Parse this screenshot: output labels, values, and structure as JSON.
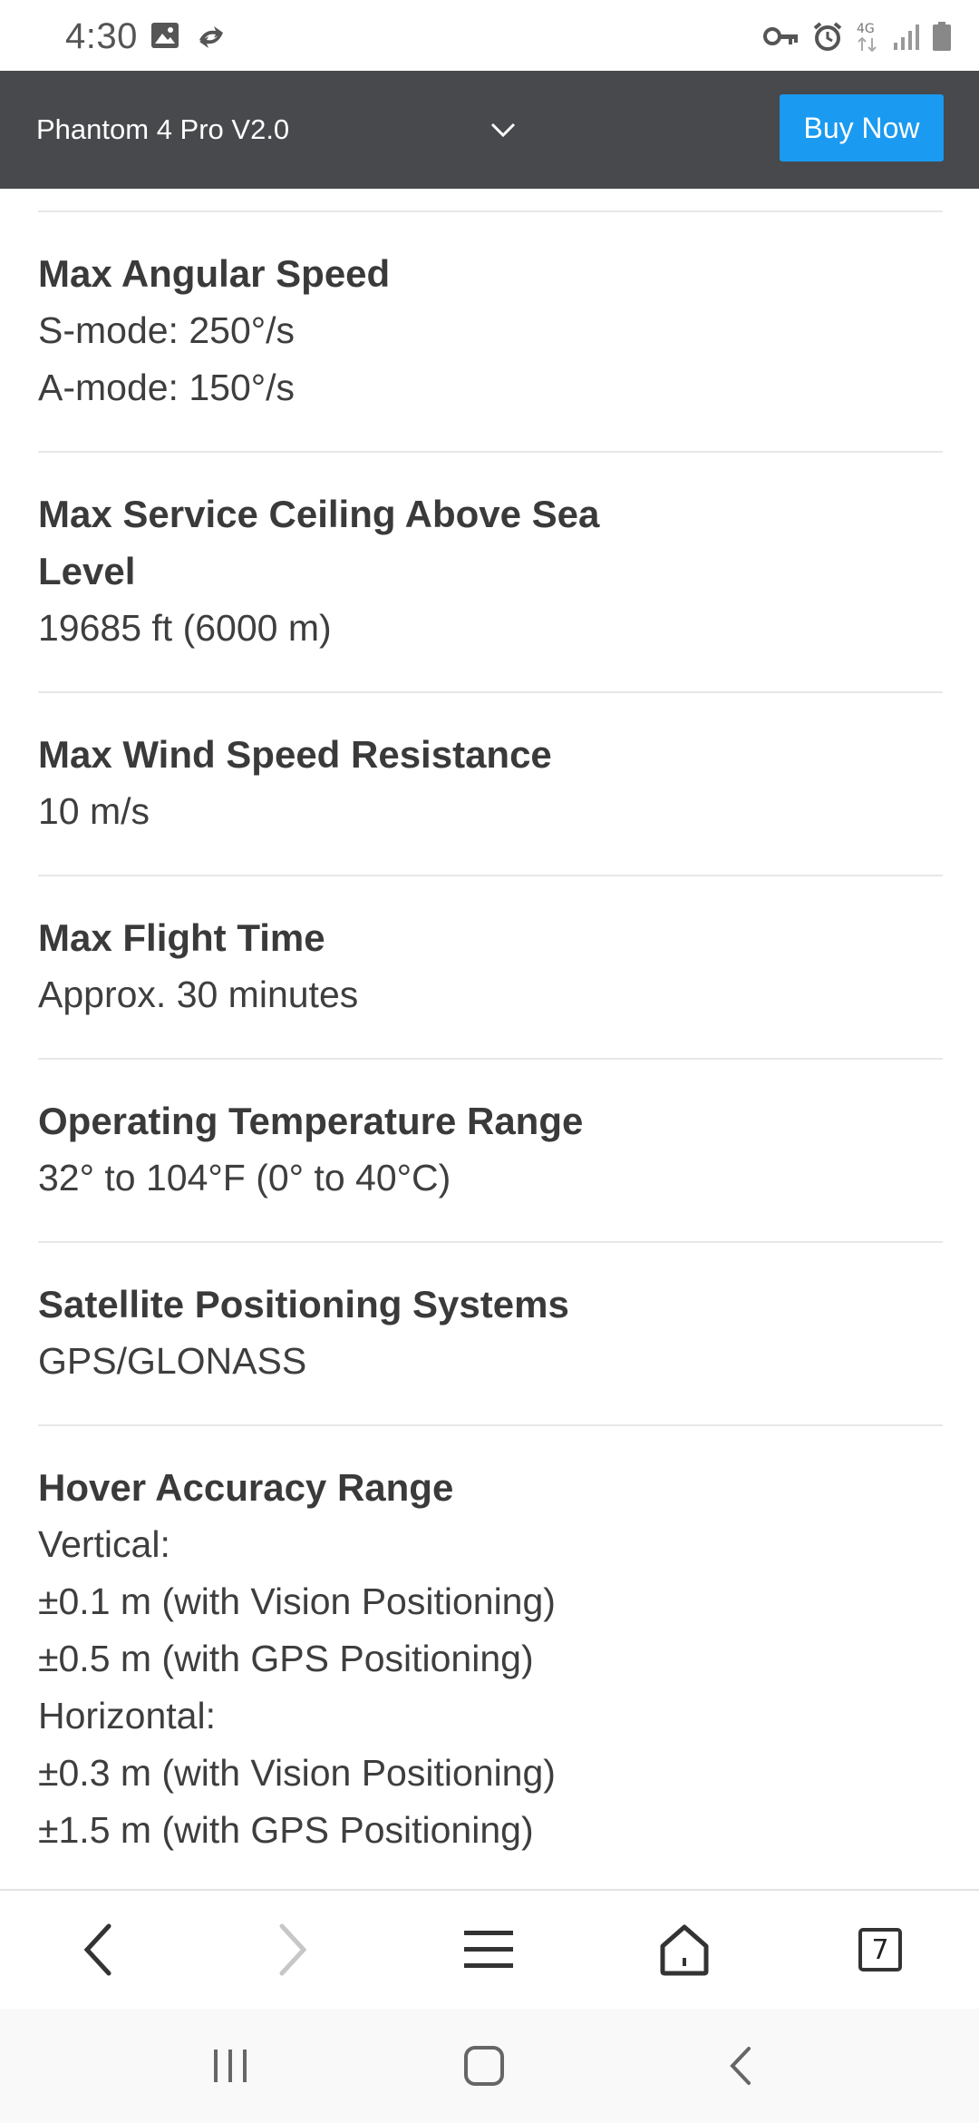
{
  "status_bar": {
    "time": "4:30",
    "left_icons": [
      "image-icon",
      "sync-icon"
    ],
    "right_icons": [
      "vpn-key-icon",
      "alarm-icon",
      "network-4g-icon",
      "signal-icon",
      "battery-icon"
    ],
    "network_label": "4G"
  },
  "header": {
    "product_name": "Phantom 4 Pro V2.0",
    "dropdown_icon": "chevron-down-icon",
    "buy_label": "Buy Now",
    "accent_color": "#1a9af0",
    "background_color": "#47494c"
  },
  "specs": [
    {
      "title": "Max Angular Speed",
      "value": "S-mode: 250°/s\nA-mode: 150°/s"
    },
    {
      "title": "Max Service Ceiling Above Sea Level",
      "value": "19685 ft (6000 m)"
    },
    {
      "title": "Max Wind Speed Resistance",
      "value": "10 m/s"
    },
    {
      "title": "Max Flight Time",
      "value": "Approx. 30 minutes"
    },
    {
      "title": "Operating Temperature Range",
      "value": "32° to 104°F (0° to 40°C)"
    },
    {
      "title": "Satellite Positioning Systems",
      "value": "GPS/GLONASS"
    },
    {
      "title": "Hover Accuracy Range",
      "value": "Vertical:\n±0.1 m (with Vision Positioning)\n±0.5 m (with GPS Positioning)\nHorizontal:\n±0.3 m (with Vision Positioning)\n±1.5 m (with GPS Positioning)"
    }
  ],
  "browser_toolbar": {
    "tabs_count": "7",
    "icons": [
      "back-icon",
      "forward-icon",
      "menu-icon",
      "home-icon",
      "tabs-icon"
    ]
  },
  "system_nav": {
    "icons": [
      "recents-icon",
      "home-button-icon",
      "system-back-icon"
    ]
  }
}
